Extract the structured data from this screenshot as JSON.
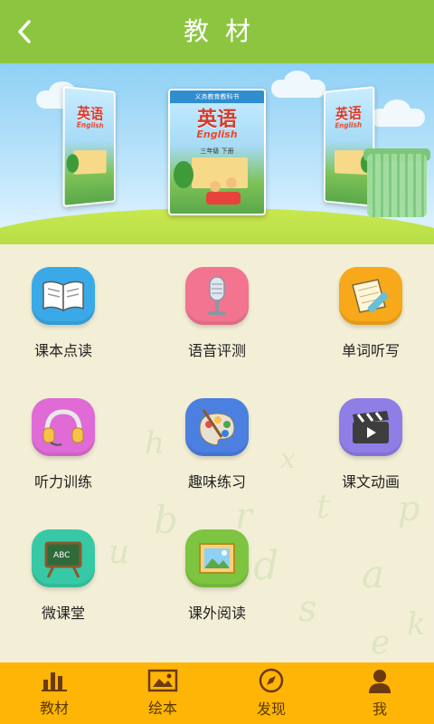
{
  "header": {
    "title": "教材",
    "back_icon": "chevron-left-icon"
  },
  "banner": {
    "books": [
      {
        "position": "left",
        "title": "英语",
        "subtitle": "English"
      },
      {
        "position": "center",
        "title": "英语",
        "subtitle": "English",
        "publisher_line": "义务教育教科书",
        "grade_line": "三年级 下册"
      },
      {
        "position": "right",
        "title": "英语",
        "subtitle": "English"
      }
    ]
  },
  "features": [
    {
      "label": "课本点读",
      "icon": "open-book-icon",
      "color": "#3aa9e8"
    },
    {
      "label": "语音评测",
      "icon": "microphone-icon",
      "color": "#f2748f"
    },
    {
      "label": "单词听写",
      "icon": "notepad-pencil-icon",
      "color": "#f7a81b"
    },
    {
      "label": "听力训练",
      "icon": "headphones-icon",
      "color": "#e06bd6"
    },
    {
      "label": "趣味练习",
      "icon": "palette-icon",
      "color": "#4b7fe0"
    },
    {
      "label": "课文动画",
      "icon": "clapperboard-icon",
      "color": "#8f7ee6"
    },
    {
      "label": "微课堂",
      "icon": "chalkboard-icon",
      "color": "#37c9a6"
    },
    {
      "label": "课外阅读",
      "icon": "picture-icon",
      "color": "#7dc540"
    }
  ],
  "tabs": [
    {
      "label": "教材",
      "icon": "bar-chart-icon"
    },
    {
      "label": "绘本",
      "icon": "picture-book-icon"
    },
    {
      "label": "发现",
      "icon": "compass-icon"
    },
    {
      "label": "我",
      "icon": "person-icon"
    }
  ],
  "colors": {
    "header": "#8cc641",
    "tabbar": "#ffb505",
    "background": "#f3efd6"
  }
}
